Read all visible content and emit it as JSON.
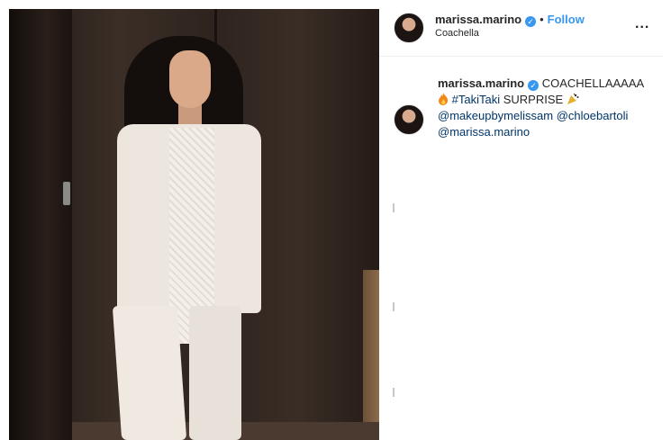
{
  "post": {
    "author": {
      "username": "marissa.marino",
      "verified_icon": "verified-badge-icon",
      "follow_separator": "•",
      "follow_label": "Follow",
      "location": "Coachella"
    },
    "more_label": "...",
    "caption": {
      "username": "marissa.marino",
      "text_line1": "COACHELLAAAAA",
      "emoji1": "fire-emoji",
      "hashtag": "#TakiTaki",
      "text_line2": "SURPRISE",
      "emoji2": "party-popper-emoji",
      "mention1": "@makeupbymelissam",
      "mention2": "@chloebartoli",
      "mention3": "@marissa.marino"
    }
  },
  "colors": {
    "accent": "#3897f0",
    "link": "#003569",
    "text": "#262626"
  }
}
